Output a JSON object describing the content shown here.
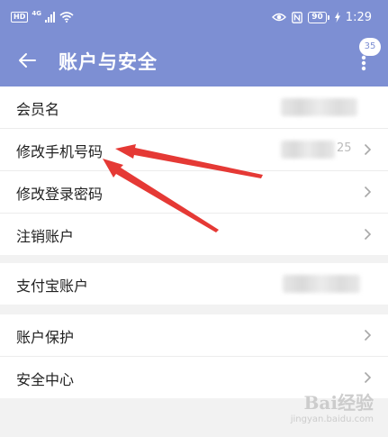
{
  "status_bar": {
    "hd": "HD",
    "network": "4G",
    "battery": "90",
    "time": "1:29"
  },
  "header": {
    "title": "账户与安全",
    "badge_count": "35"
  },
  "groups": [
    {
      "items": [
        {
          "label": "会员名"
        },
        {
          "label": "修改手机号码",
          "suffix": "25"
        },
        {
          "label": "修改登录密码"
        },
        {
          "label": "注销账户"
        }
      ]
    },
    {
      "items": [
        {
          "label": "支付宝账户"
        }
      ]
    },
    {
      "items": [
        {
          "label": "账户保护"
        },
        {
          "label": "安全中心"
        }
      ]
    }
  ],
  "watermark": {
    "logo": "Bai经验",
    "url": "jingyan.baidu.com"
  },
  "colors": {
    "header": "#7d8fd3",
    "annotation_arrow": "#e53935"
  }
}
